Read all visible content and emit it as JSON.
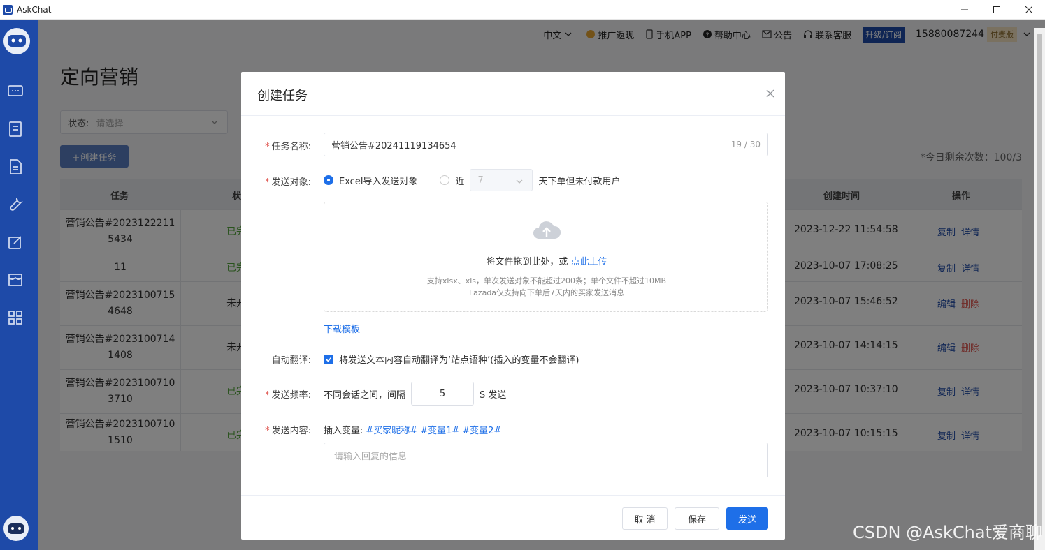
{
  "window": {
    "title": "AskChat"
  },
  "topbar": {
    "language": "中文",
    "promo": "推广返现",
    "mobile_app": "手机APP",
    "help": "帮助中心",
    "announcement": "公告",
    "support": "联系客服",
    "upgrade": "升级/订阅",
    "phone": "15880087244",
    "plan_badge": "付费版"
  },
  "page": {
    "title": "定向营销",
    "status_filter": {
      "label": "状态:",
      "placeholder": "请选择"
    },
    "create_button": "+创建任务",
    "remaining": "*今日剩余次数：100/3"
  },
  "table": {
    "headers": {
      "task": "任务",
      "status": "状",
      "created": "创建时间",
      "ops": "操作"
    },
    "rows": [
      {
        "task": [
          "营销公告#2023122211",
          "5434"
        ],
        "status": "已完",
        "created": "2023-12-22 11:54:58",
        "op1": "复制",
        "op2": "详情"
      },
      {
        "task": [
          "11"
        ],
        "status": "已完",
        "created": "2023-10-07 17:08:25",
        "op1": "复制",
        "op2": "详情"
      },
      {
        "task": [
          "营销公告#2023100715",
          "4648"
        ],
        "status": "未开",
        "created": "2023-10-07 15:46:52",
        "op1": "编辑",
        "op2": "删除"
      },
      {
        "task": [
          "营销公告#2023100714",
          "1408"
        ],
        "status": "未开",
        "created": "2023-10-07 14:14:15",
        "op1": "编辑",
        "op2": "删除"
      },
      {
        "task": [
          "营销公告#2023100710",
          "3710"
        ],
        "status": "已完",
        "created": "2023-10-07 10:37:10",
        "op1": "复制",
        "op2": "详情"
      },
      {
        "task": [
          "营销公告#2023100710",
          "1510"
        ],
        "status": "已完",
        "created": "2023-10-07 10:15:15",
        "op1": "复制",
        "op2": "详情"
      }
    ]
  },
  "modal": {
    "title": "创建任务",
    "task_name": {
      "label": "任务名称:",
      "value": "营销公告#20241119134654",
      "counter": "19 / 30"
    },
    "target": {
      "label": "发送对象:",
      "option_excel": "Excel导入发送对象",
      "option_recent_prefix": "近",
      "days_value": "7",
      "option_recent_suffix": "天下单但未付款用户"
    },
    "upload": {
      "drag_text": "将文件拖到此处，或",
      "upload_link": "点此上传",
      "hint1": "支持xlsx、xls，单次发送对象不能超过200条；单个文件不超过10MB",
      "hint2": "Lazada仅支持向下单后7天内的买家发送消息"
    },
    "download_template": "下载模板",
    "translate": {
      "label": "自动翻译:",
      "text": "将发送文本内容自动翻译为‘站点语种’(插入的变量不会翻译)"
    },
    "frequency": {
      "label": "发送频率:",
      "prefix": "不同会话之间，间隔",
      "value": "5",
      "suffix": "S 发送"
    },
    "content": {
      "label": "发送内容:",
      "vars_label": "插入变量:",
      "vars": [
        "#买家昵称#",
        "#变量1#",
        "#变量2#"
      ],
      "placeholder": "请输入回复的信息"
    },
    "buttons": {
      "cancel": "取 消",
      "save": "保存",
      "send": "发送"
    }
  },
  "watermark": "CSDN @AskChat爱商聊"
}
